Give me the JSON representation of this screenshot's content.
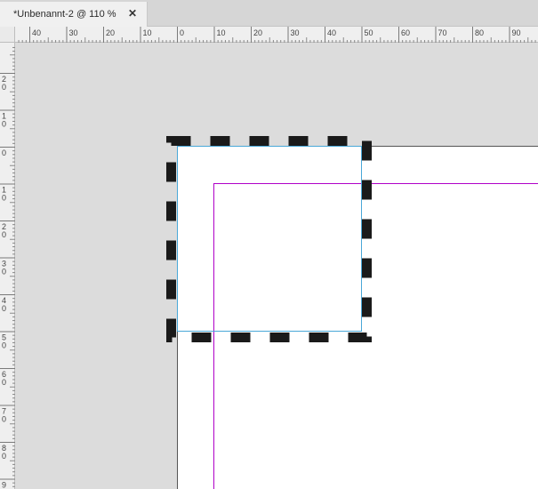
{
  "tab": {
    "title": "*Unbenannt-2 @ 110 %",
    "close_glyph": "✕"
  },
  "rulers": {
    "horizontal_labels": [
      "40",
      "30",
      "20",
      "10",
      "0",
      "10",
      "20",
      "30",
      "40",
      "50",
      "60",
      "70",
      "80",
      "90"
    ],
    "vertical_labels": [
      "2\n0",
      "1\n0",
      "0",
      "1\n0",
      "2\n0",
      "3\n0",
      "4\n0",
      "5\n0",
      "6\n0",
      "7\n0",
      "8\n0",
      "9"
    ]
  },
  "colors": {
    "pasteboard": "#dcdcdc",
    "page": "#ffffff",
    "margin_guide": "#b000c8",
    "frame_edge": "#4aa8d8",
    "dash_stroke": "#1a1a1a"
  },
  "icons": {
    "close": "close-icon"
  }
}
